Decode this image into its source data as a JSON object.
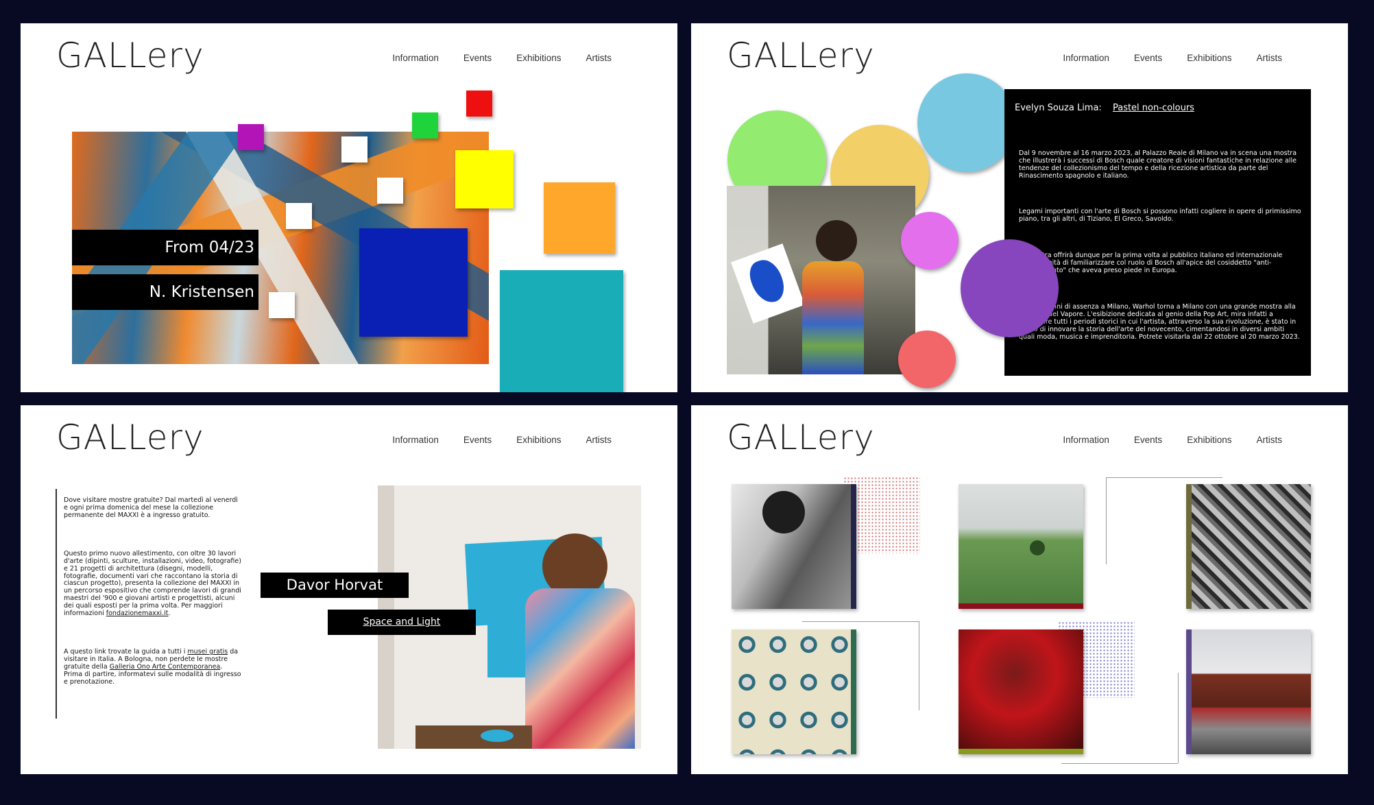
{
  "logo": "GALLery",
  "nav": [
    "Information",
    "Events",
    "Exhibitions",
    "Artists"
  ],
  "panel1": {
    "date_label": "From 04/23",
    "artist_label": "N. Kristensen"
  },
  "panel2": {
    "heading_name": "Evelyn Souza Lima:",
    "heading_link": "Pastel non-colours",
    "paragraphs": [
      "Dal 9 novembre al 16 marzo 2023, al Palazzo Reale di Milano va in scena una mostra che illustrerà i successi di Bosch quale creatore di visioni fantastiche in relazione alle tendenze del collezionismo del tempo e della ricezione artistica da parte del Rinascimento spagnolo e italiano.",
      "Legami importanti con l'arte di Bosch si possono infatti cogliere in opere di primissimo piano, tra gli altri, di Tiziano, El Greco, Savoldo.",
      "La mostra offrirà dunque per la prima volta al pubblico italiano ed internazionale l'opportunità di familiarizzare col ruolo di Bosch all'apice del cosiddetto \"anti-Rinascimento\" che aveva preso piede in Europa.",
      "Dopo 10 anni di assenza a Milano, Warhol torna a Milano con una grande mostra alla Fabbrica del Vapore. L'esibizione dedicata al genio della Pop Art, mira infatti a ricostruire tutti i periodi storici in cui l'artista, attraverso la sua rivoluzione, è stato in grado di innovare la storia dell'arte del novecento, cimentandosi in diversi ambiti quali moda, musica e imprenditoria. Potrete visitarla dal 22 ottobre al 20 marzo 2023."
    ]
  },
  "panel3": {
    "para1": "Dove visitare mostre gratuite? Dal martedì al venerdì e ogni prima domenica del mese la collezione permanente del MAXXI è a ingresso gratuito.",
    "para2_text": "Questo primo nuovo allestimento, con oltre 30 lavori d'arte (dipinti, sculture, installazioni, video, fotografie) e 21 progetti di architettura (disegni, modelli, fotografie, documenti vari che raccontano la storia di ciascun progetto), presenta la collezione del MAXXI in un percorso espositivo che comprende lavori di grandi maestri del '900 e giovani artisti e progettisti, alcuni dei quali esposti per la prima volta. Per maggiori informazioni",
    "para2_link": "fondazionemaxxi.it",
    "para3_a": "A questo link trovate la guida a tutti i",
    "para3_link1": "musei gratis",
    "para3_b": "da visitare in Italia. A Bologna, non perdete le mostre gratuite della",
    "para3_link2": "Galleria Ono Arte Contemporanea",
    "para3_c": ". Prima di partire, informatevi sulle modalità di ingresso e prenotazione.",
    "name_label": "Davor Horvat",
    "title_link": "Space and Light"
  },
  "colors": {
    "background": "#080a24",
    "panel": "#ffffff",
    "squares": [
      "#b214b8",
      "#1fd43a",
      "#ee1010",
      "#ffff00",
      "#ffa72a",
      "#0a20b4",
      "#19adb8"
    ],
    "circles": [
      "#93ec6f",
      "#f2cf67",
      "#79c8e2",
      "#e36fed",
      "#8746bd",
      "#f26669"
    ]
  }
}
